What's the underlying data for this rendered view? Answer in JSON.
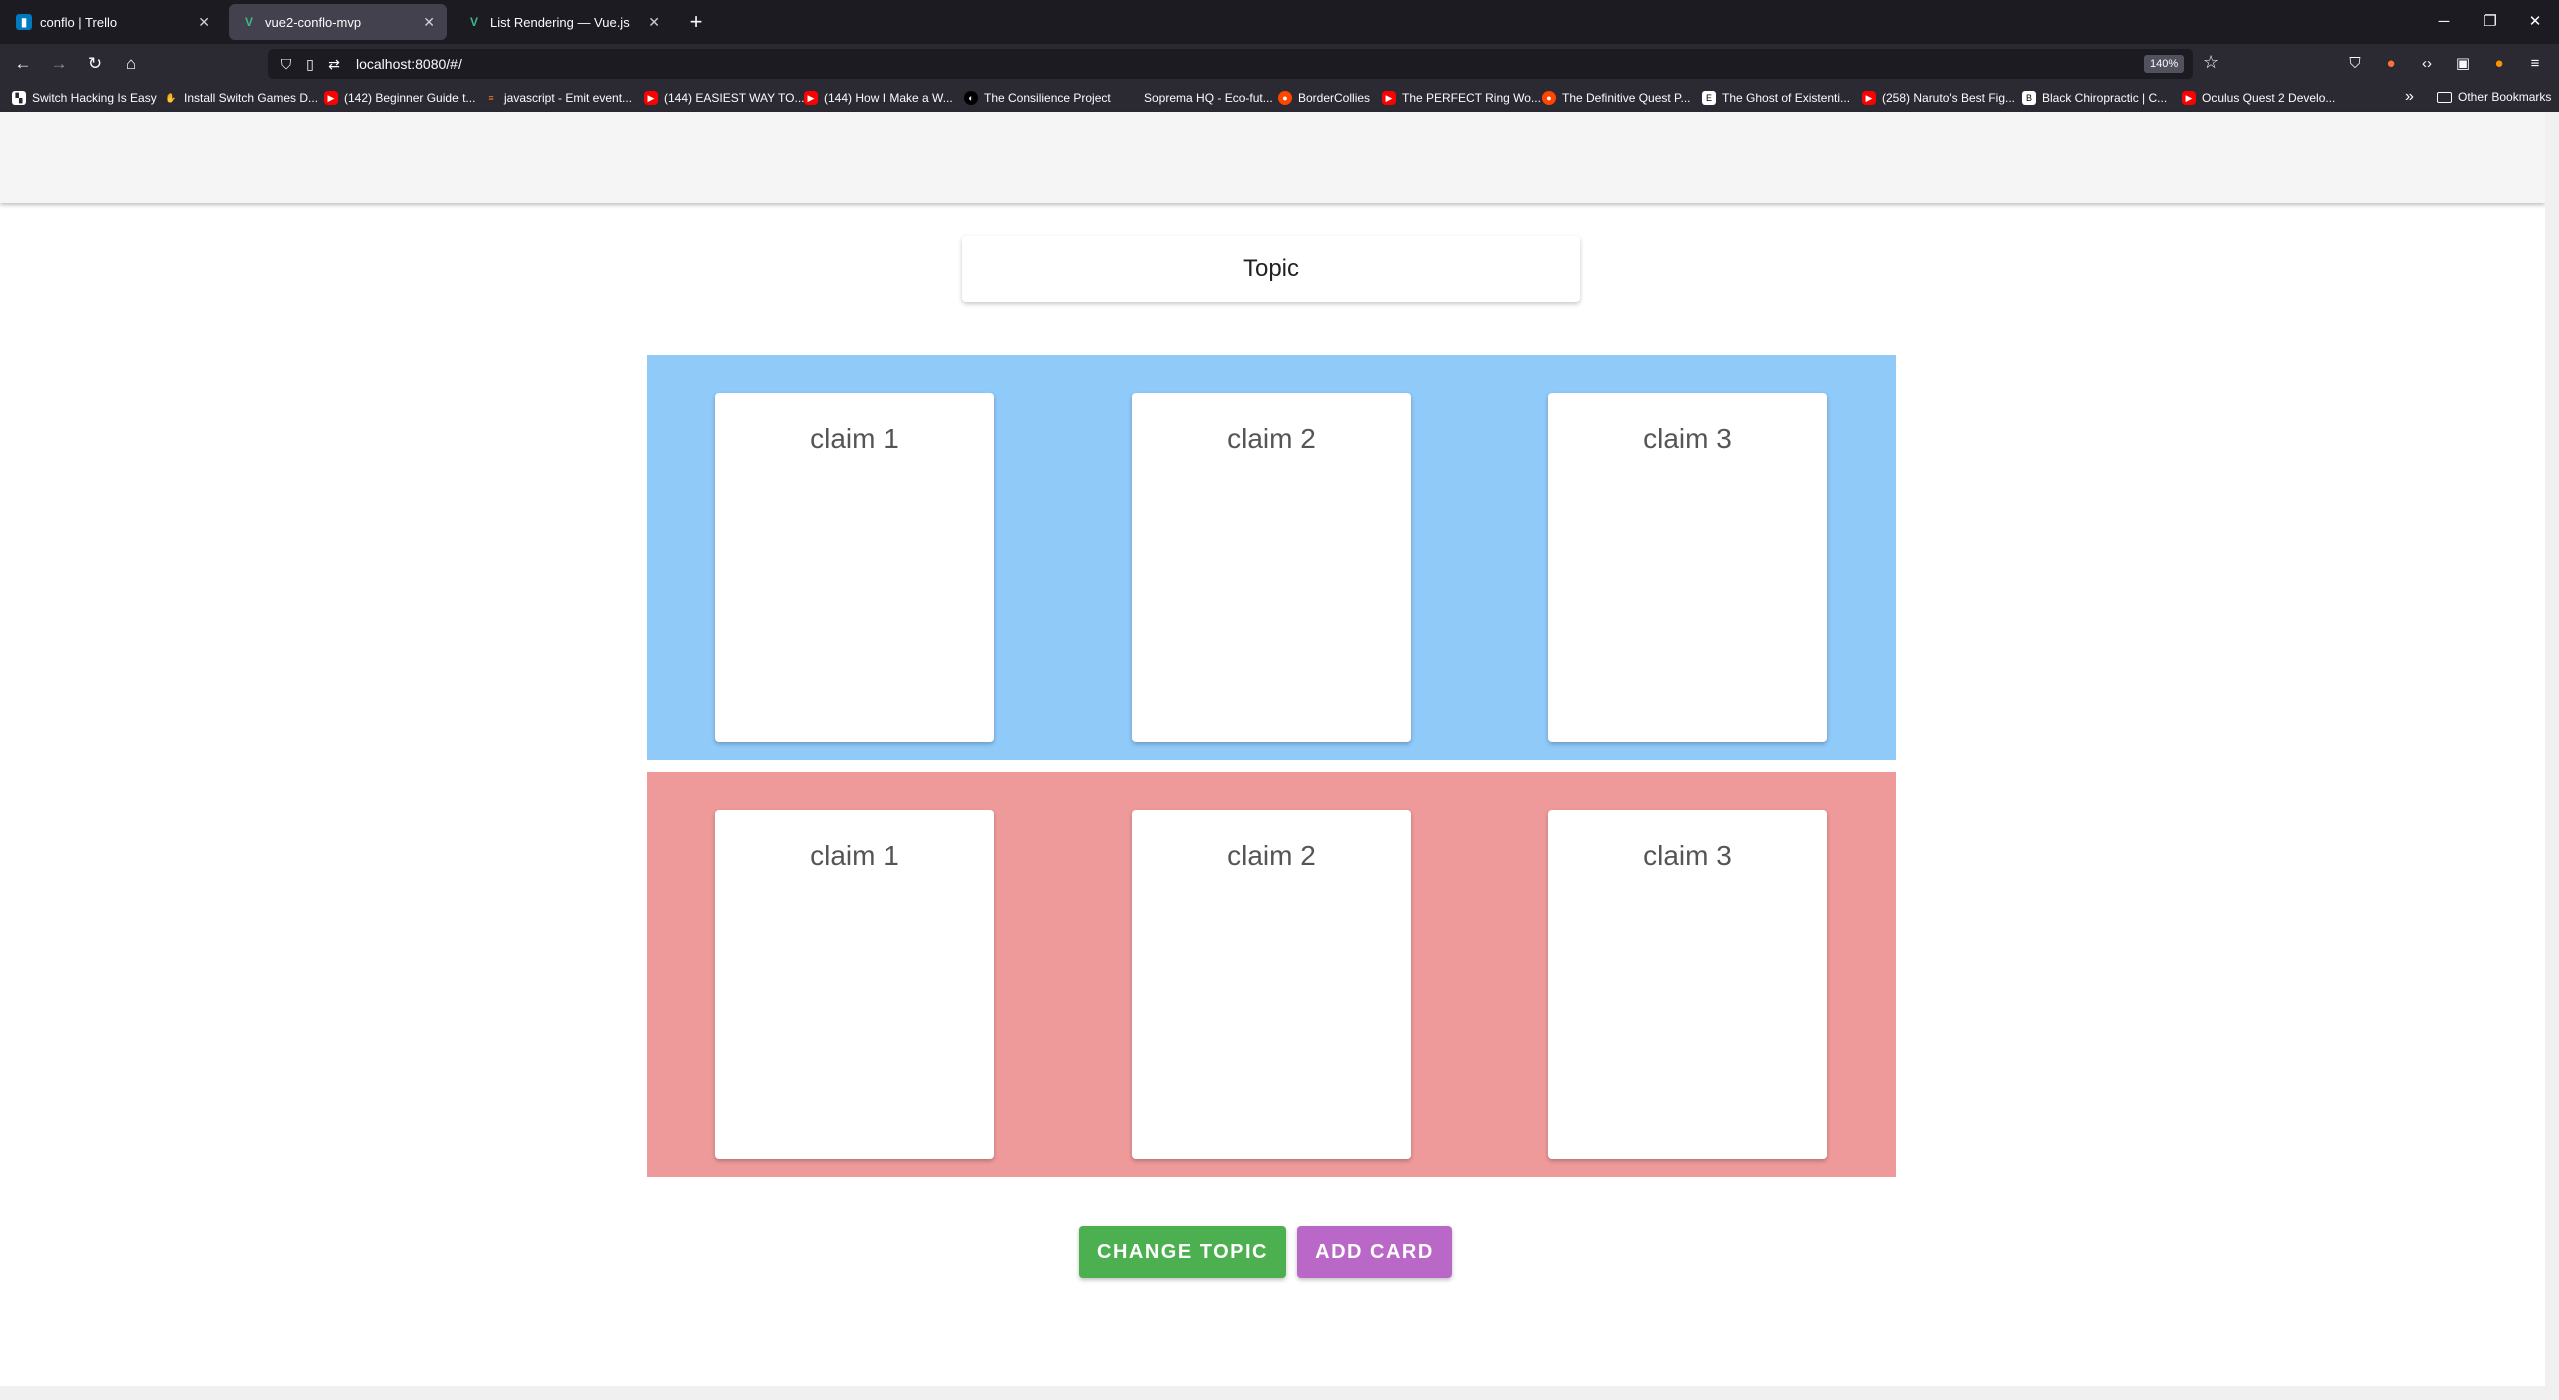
{
  "browser": {
    "tabs": [
      {
        "title": "conflo | Trello",
        "icon": "trello-icon"
      },
      {
        "title": "vue2-conflo-mvp",
        "icon": "vue-icon"
      },
      {
        "title": "List Rendering — Vue.js",
        "icon": "vue-icon"
      }
    ],
    "url": "localhost:8080/#/",
    "zoom": "140%",
    "bookmarks": [
      "Switch Hacking Is Easy",
      "Install Switch Games D...",
      "(142) Beginner Guide t...",
      "javascript - Emit event...",
      "(144) EASIEST WAY TO...",
      "(144) How I Make a W...",
      "The Consilience Project",
      "Soprema HQ - Eco-fut...",
      "BorderCollies",
      "The PERFECT Ring Wo...",
      "The Definitive Quest P...",
      "The Ghost of Existenti...",
      "(258) Naruto's Best Fig...",
      "Black Chiropractic | C...",
      "Oculus Quest 2 Develo..."
    ],
    "other_bookmarks": "Other Bookmarks"
  },
  "app": {
    "topic": "Topic",
    "pro_claims": [
      "claim 1",
      "claim 2",
      "claim 3"
    ],
    "con_claims": [
      "claim 1",
      "claim 2",
      "claim 3"
    ],
    "change_topic_label": "CHANGE TOPIC",
    "add_card_label": "ADD CARD",
    "colors": {
      "pro_section": "#90caf9",
      "con_section": "#ef9a9a",
      "change_button": "#4caf50",
      "add_button": "#ba68c8"
    }
  }
}
